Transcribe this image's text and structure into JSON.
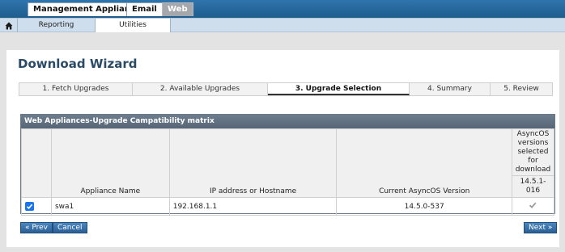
{
  "product_tabs": [
    {
      "label": "Management Appliance"
    },
    {
      "label": "Email"
    },
    {
      "label": "Web"
    }
  ],
  "nav": {
    "home_icon": "home-icon",
    "tabs": [
      {
        "label": "Reporting"
      },
      {
        "label": "Utilities"
      }
    ]
  },
  "page": {
    "title": "Download Wizard"
  },
  "steps": [
    {
      "label": "1. Fetch Upgrades"
    },
    {
      "label": "2. Available Upgrades"
    },
    {
      "label": "3. Upgrade Selection"
    },
    {
      "label": "4. Summary"
    },
    {
      "label": "5. Review"
    }
  ],
  "matrix": {
    "title": "Web Appliances-Upgrade Campatibility matrix",
    "headers": {
      "name": "Appliance Name",
      "ip": "IP address or Hostname",
      "version": "Current AsyncOS Version",
      "asyncos": "AsyncOS versions selected for download",
      "asyncos_version": "14.5.1-016"
    },
    "rows": [
      {
        "checked": true,
        "name": "swa1",
        "ip": "192.168.1.1",
        "version": "14.5.0-537",
        "status_icon": "checkmark-icon"
      }
    ]
  },
  "buttons": {
    "prev": "« Prev",
    "cancel": "Cancel",
    "next": "Next »"
  },
  "colors": {
    "header_blue": "#2f75ad",
    "title_text": "#2b4a66",
    "button_blue": "#2a5f94"
  }
}
